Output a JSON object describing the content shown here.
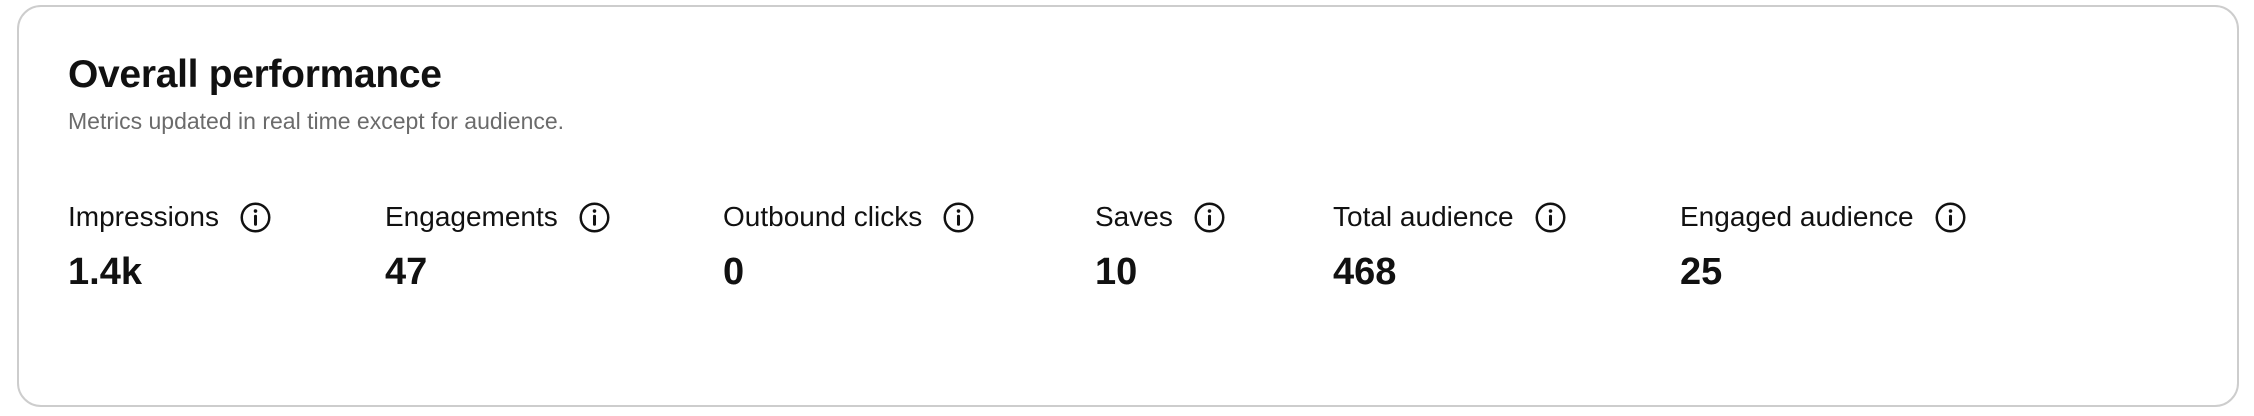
{
  "card": {
    "title": "Overall performance",
    "subtitle": "Metrics updated in real time except for audience."
  },
  "metrics": [
    {
      "label": "Impressions",
      "value": "1.4k",
      "icon": "info-icon"
    },
    {
      "label": "Engagements",
      "value": "47",
      "icon": "info-icon"
    },
    {
      "label": "Outbound clicks",
      "value": "0",
      "icon": "info-icon"
    },
    {
      "label": "Saves",
      "value": "10",
      "icon": "info-icon"
    },
    {
      "label": "Total audience",
      "value": "468",
      "icon": "info-icon"
    },
    {
      "label": "Engaged audience",
      "value": "25",
      "icon": "info-icon"
    }
  ],
  "colors": {
    "text": "#111111",
    "muted": "#6b6b6b",
    "border": "#cdcdcd"
  }
}
